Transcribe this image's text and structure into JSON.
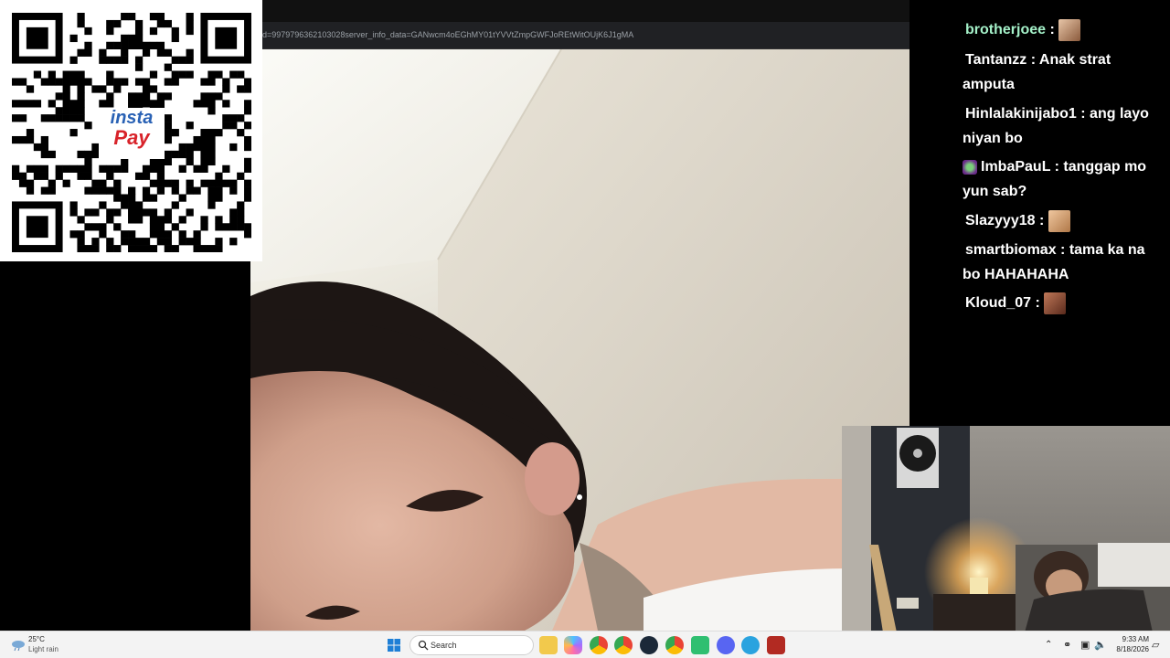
{
  "browser": {
    "url": "d=9979796362103028server_info_data=GANwcm4oEGhMY01tYVVtZmpGWFJoREtWitOUjK6J1gMA"
  },
  "qr_overlay": {
    "logo_line1": "insta",
    "logo_line2": "Pay"
  },
  "chat": {
    "messages": [
      {
        "user": "brotherjoee",
        "text": "",
        "color": "#a4f0c8",
        "emote": "face-emote"
      },
      {
        "user": "Tantanzz",
        "text": "Anak strat amputa",
        "color": "#f0d9a8"
      },
      {
        "user": "Hinlalakinijabo1",
        "text": "ang layo niyan bo",
        "color": "#7ff0ff"
      },
      {
        "user": "ImbaPauL",
        "text": "tanggap mo yun sab?",
        "color": "#9ff0c8",
        "badge": "joker-badge"
      },
      {
        "user": "Slazyyy18",
        "text": "",
        "color": "#b8f0d0",
        "emote": "face-emote"
      },
      {
        "user": "smartbiomax",
        "text": "tama ka na bo HAHAHAHA",
        "color": "#d4a8f0"
      },
      {
        "user": "Kloud_07",
        "text": "",
        "color": "#f4b8d8",
        "emote": "face-emote"
      }
    ]
  },
  "taskbar": {
    "weather_temp": "25°C",
    "weather_cond": "Light rain",
    "search_label": "Search",
    "time": "9:33 AM",
    "date": "8/18/2026",
    "apps": [
      "windows-start",
      "search",
      "file-explorer",
      "copilot",
      "chrome",
      "chrome-profile",
      "steam",
      "chrome-profile-2",
      "whatsapp-like",
      "discord",
      "telegram",
      "dota2"
    ]
  }
}
